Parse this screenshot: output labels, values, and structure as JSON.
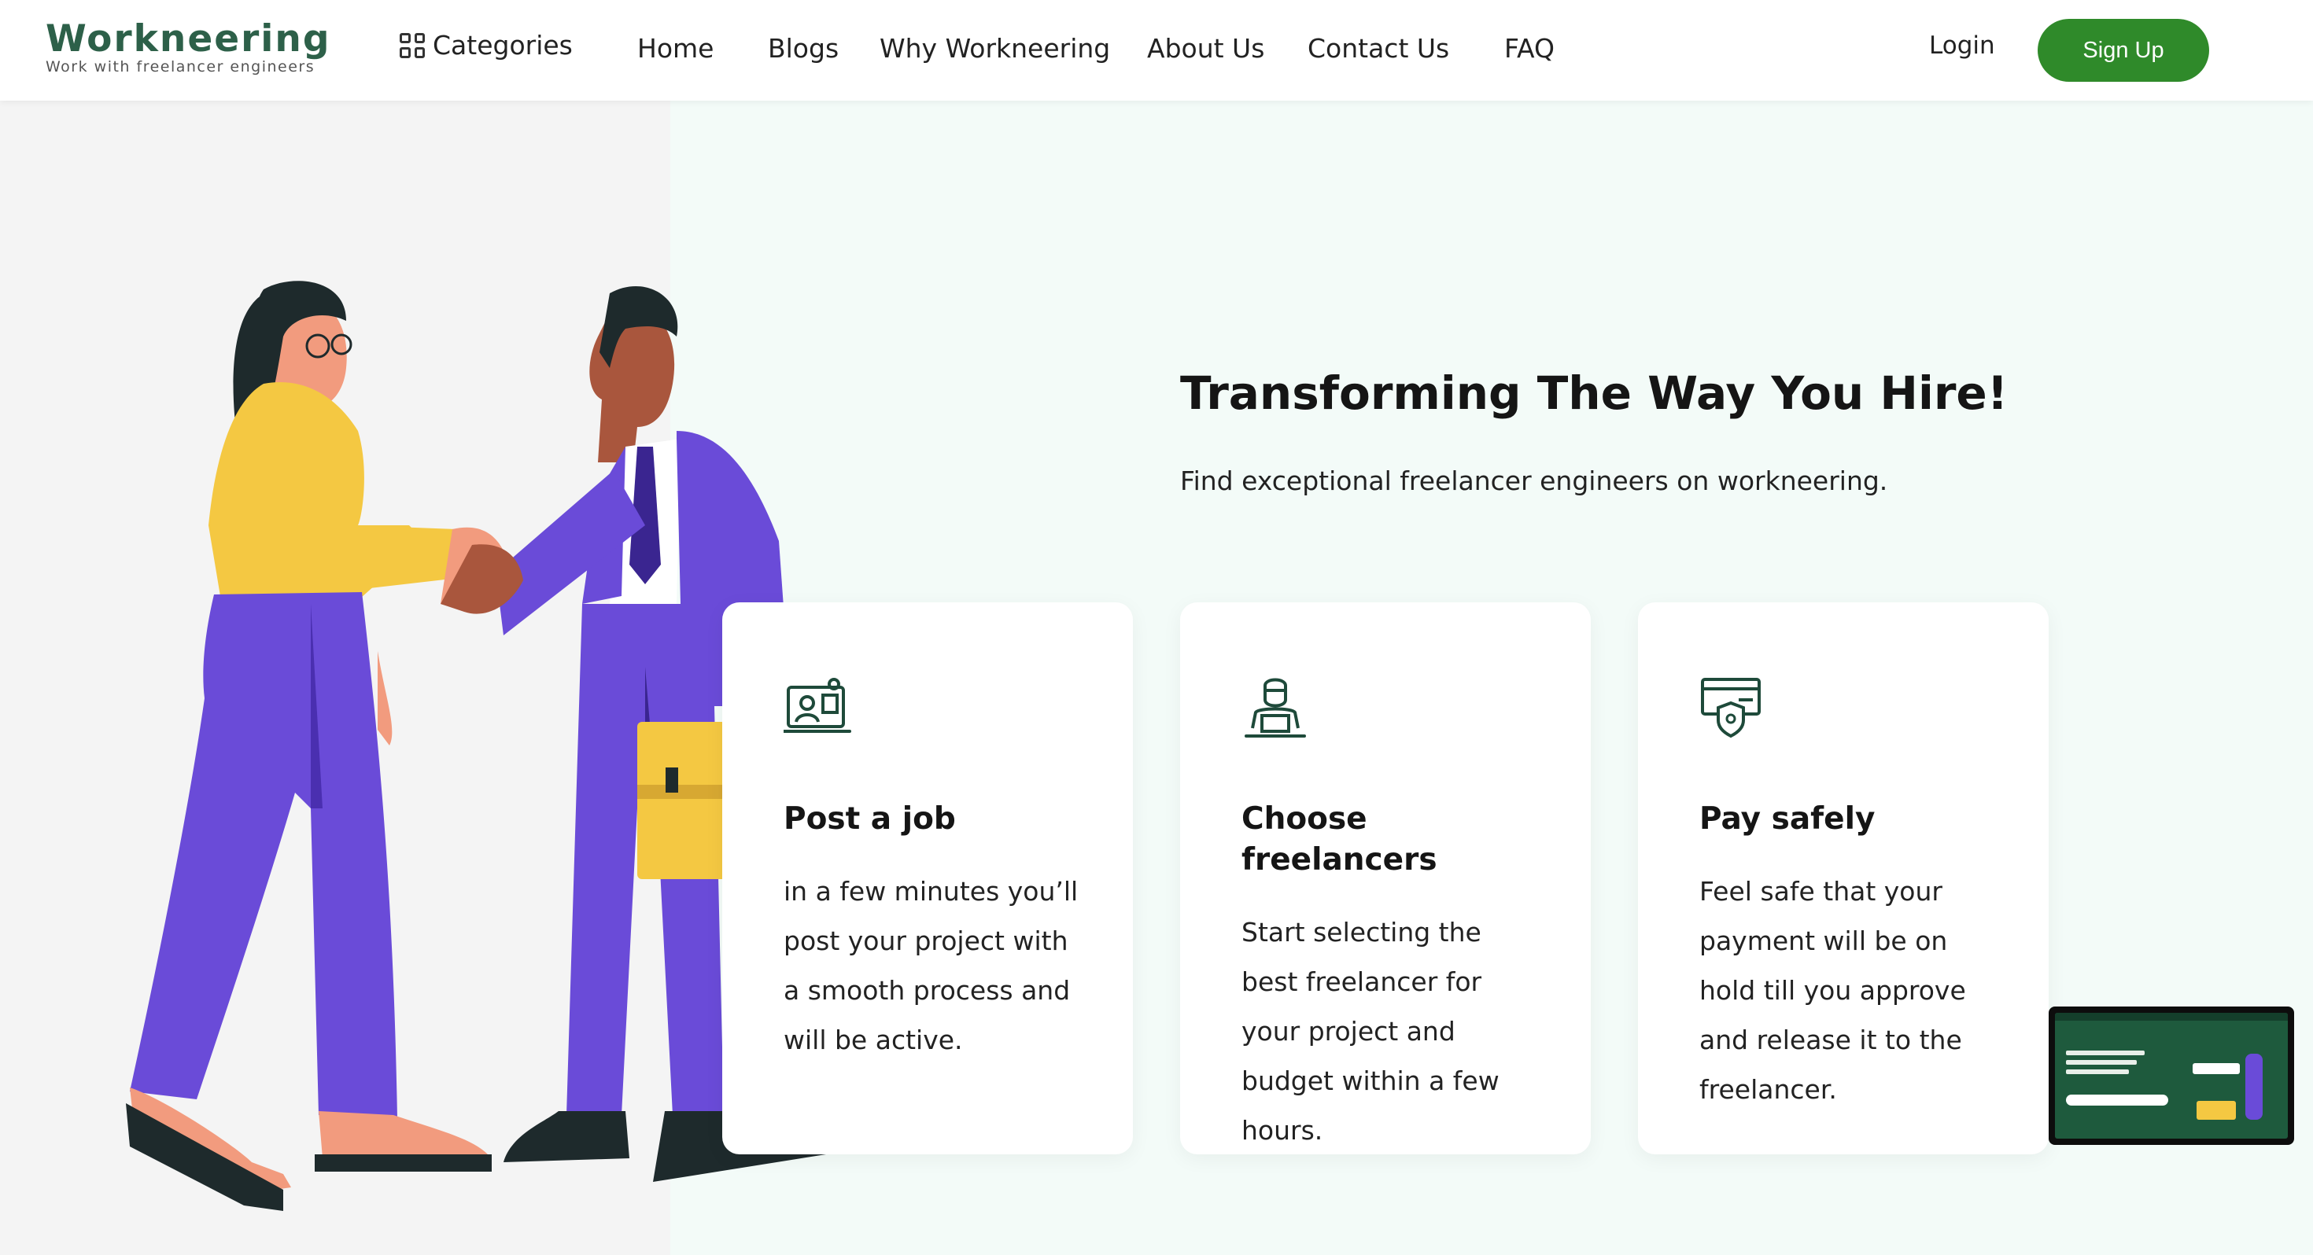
{
  "nav": {
    "logo_word": "Workneering",
    "logo_tagline": "Work with freelancer engineers",
    "categories": "Categories",
    "links": [
      "Home",
      "Blogs",
      "Why Workneering",
      "About Us",
      "Contact Us",
      "FAQ"
    ],
    "login": "Login",
    "signup": "Sign Up"
  },
  "hero": {
    "title": "Transforming The Way You Hire!",
    "subtitle": "Find exceptional freelancer engineers on workneering."
  },
  "cards": [
    {
      "icon": "job-post-icon",
      "title": "Post a job",
      "text": "in a few minutes you’ll post your project with a smooth process and will be active."
    },
    {
      "icon": "freelancer-icon",
      "title": "Choose freelancers",
      "text": "Start selecting the best freelancer for your project and budget within a few hours."
    },
    {
      "icon": "payment-shield-icon",
      "title": "Pay safely",
      "text": "Feel safe that your payment will be on hold till you approve and release it to the freelancer."
    }
  ],
  "colors": {
    "brand_green": "#2f8a2a",
    "logo_green": "#2d6049",
    "page_bg": "#f3fbf8",
    "illustration_purple": "#6a4bd8",
    "illustration_yellow": "#f4c842"
  }
}
